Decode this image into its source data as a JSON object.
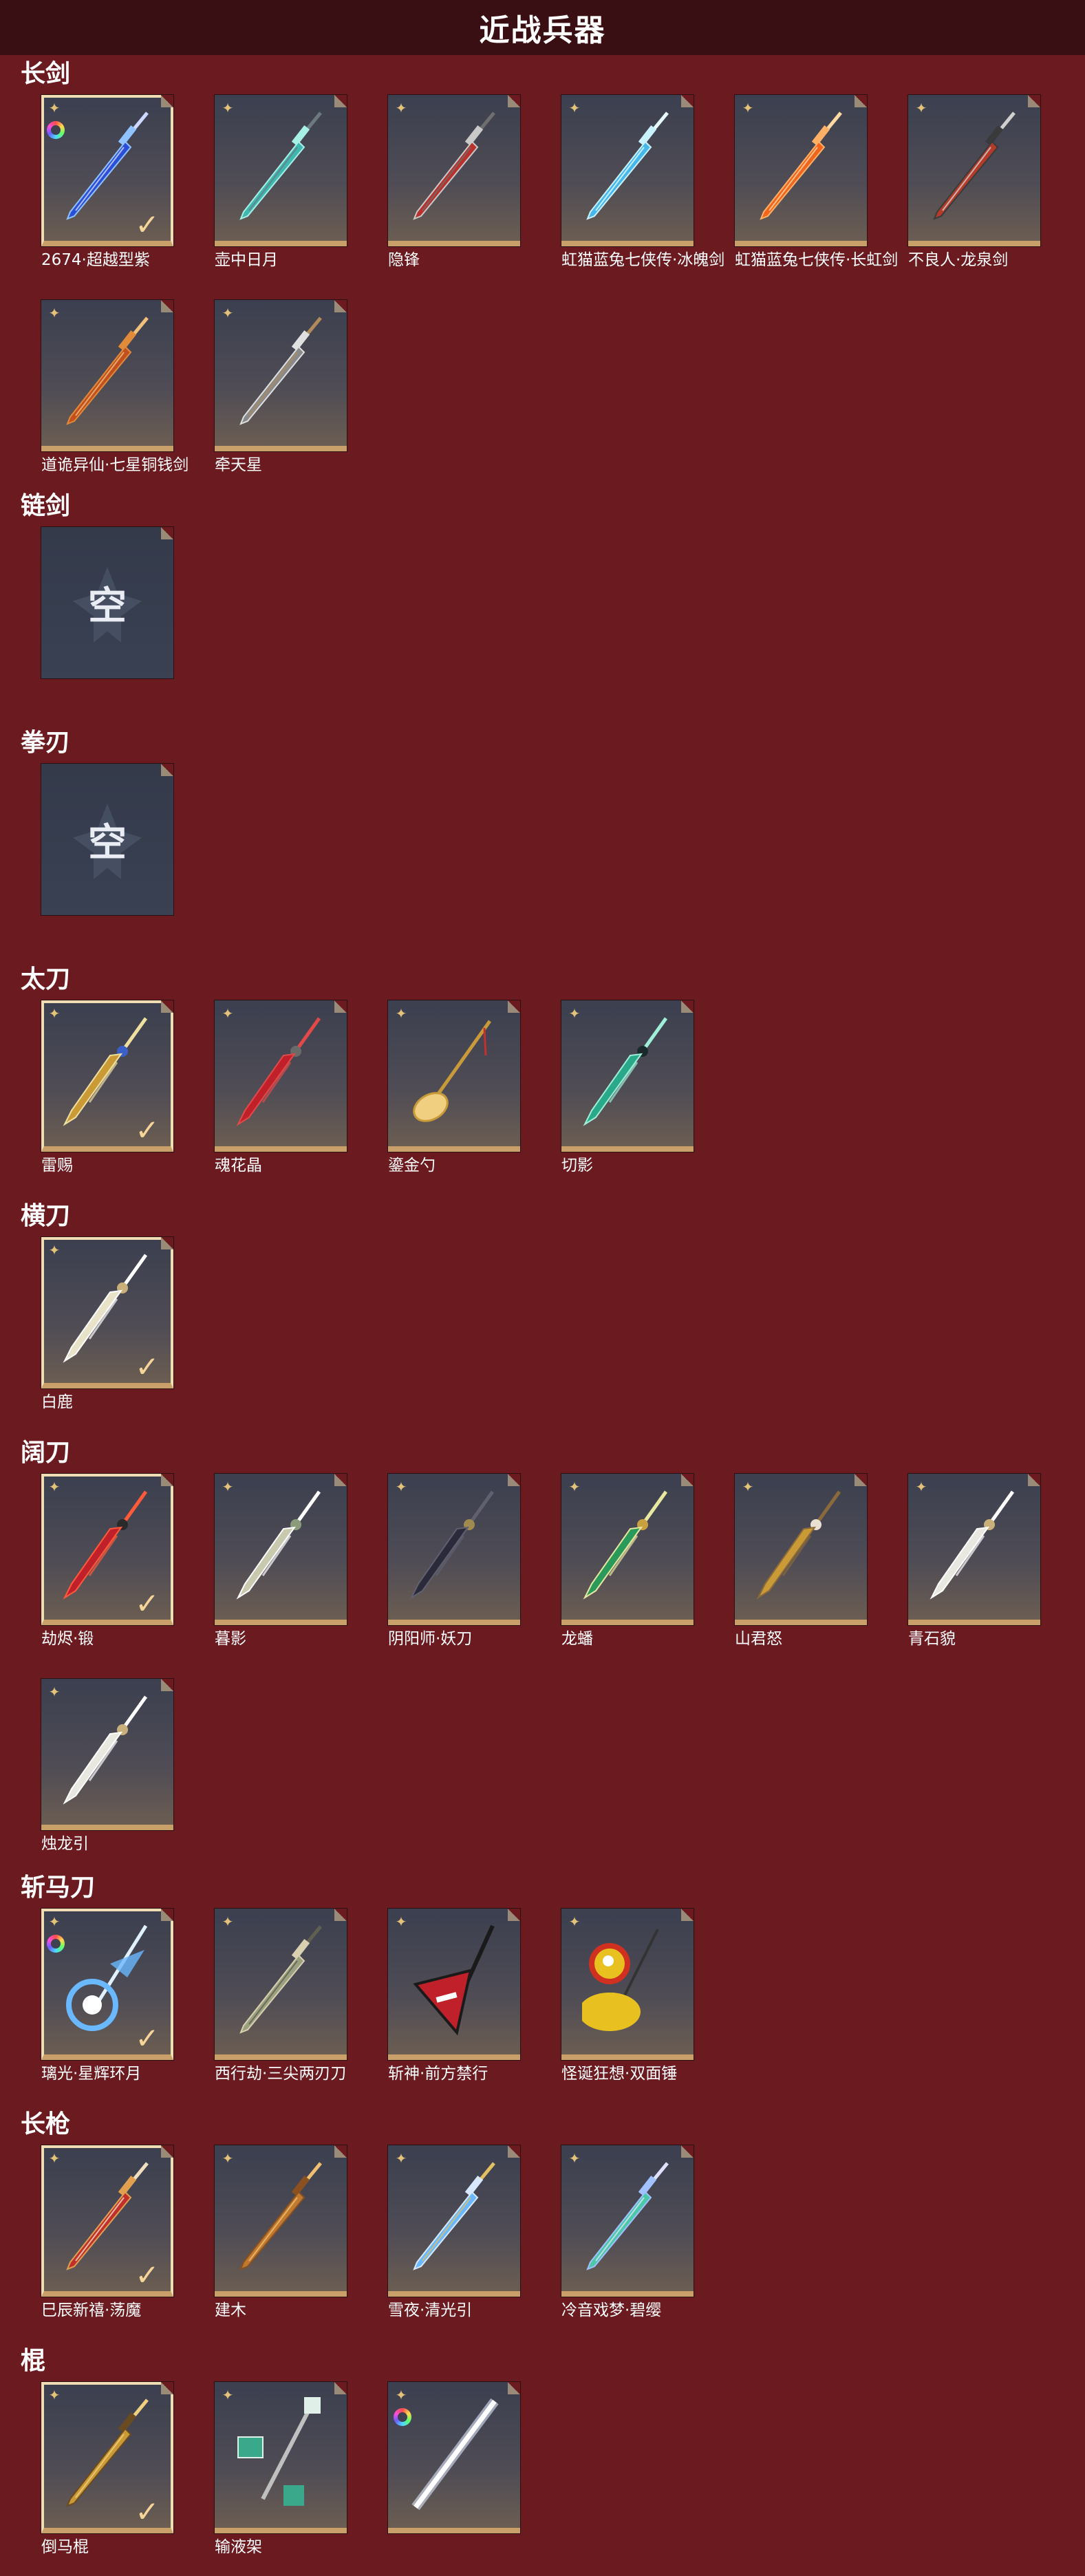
{
  "header": {
    "title": "近战兵器"
  },
  "sections": [
    {
      "title": "长剑",
      "items": [
        {
          "label": "2674·超越型紫",
          "selected": true,
          "rainbow": true,
          "art": "sword-blue"
        },
        {
          "label": "壶中日月",
          "art": "sword-cyan"
        },
        {
          "label": "隐锋",
          "art": "sword-red"
        },
        {
          "label": "虹猫蓝兔七侠传·冰魄剑",
          "art": "sword-ice"
        },
        {
          "label": "虹猫蓝兔七侠传·长虹剑",
          "art": "sword-orange"
        },
        {
          "label": "不良人·龙泉剑",
          "art": "sword-dark"
        },
        {
          "label": "道诡异仙·七星铜钱剑",
          "art": "sword-coin"
        },
        {
          "label": "牵天星",
          "art": "sword-silver"
        }
      ]
    },
    {
      "title": "链剑",
      "items": [
        {
          "label": "",
          "empty": true,
          "empty_text": "空"
        }
      ]
    },
    {
      "title": "拳刃",
      "items": [
        {
          "label": "",
          "empty": true,
          "empty_text": "空"
        }
      ]
    },
    {
      "title": "太刀",
      "items": [
        {
          "label": "雷赐",
          "selected": true,
          "art": "blade-gold"
        },
        {
          "label": "魂花晶",
          "art": "blade-crimson"
        },
        {
          "label": "鎏金勺",
          "art": "spoon"
        },
        {
          "label": "切影",
          "art": "blade-jade"
        }
      ]
    },
    {
      "title": "横刀",
      "items": [
        {
          "label": "白鹿",
          "selected": true,
          "art": "blade-white"
        }
      ]
    },
    {
      "title": "阔刀",
      "items": [
        {
          "label": "劫烬·锻",
          "selected": true,
          "art": "broad-red"
        },
        {
          "label": "暮影",
          "art": "broad-silver"
        },
        {
          "label": "阴阳师·妖刀",
          "art": "broad-dark"
        },
        {
          "label": "龙蟠",
          "art": "broad-green"
        },
        {
          "label": "山君怒",
          "art": "broad-gold"
        },
        {
          "label": "青石貌",
          "art": "broad-white"
        },
        {
          "label": "烛龙引",
          "art": "broad-white"
        }
      ]
    },
    {
      "title": "斩马刀",
      "items": [
        {
          "label": "璃光·星辉环月",
          "selected": true,
          "rainbow": true,
          "art": "zhanma-moon"
        },
        {
          "label": "西行劫·三尖两刃刀",
          "art": "zhanma-trident"
        },
        {
          "label": "斩神·前方禁行",
          "art": "zhanma-sign"
        },
        {
          "label": "怪诞狂想·双面锤",
          "art": "zhanma-hammer"
        }
      ]
    },
    {
      "title": "长枪",
      "items": [
        {
          "label": "巳辰新禧·荡魔",
          "selected": true,
          "art": "spear-red"
        },
        {
          "label": "建木",
          "art": "spear-wood"
        },
        {
          "label": "雪夜·清光引",
          "art": "spear-ice"
        },
        {
          "label": "冷音戏梦·碧缨",
          "art": "spear-jade"
        }
      ]
    },
    {
      "title": "棍",
      "items": [
        {
          "label": "倒马棍",
          "selected": true,
          "art": "staff-gold"
        },
        {
          "label": "输液架",
          "art": "staff-iv"
        },
        {
          "label": "",
          "rainbow": true,
          "art": "staff-light"
        }
      ]
    }
  ],
  "colors": {
    "background": "#6b1a1f",
    "header": "#3a0f14",
    "card_border": "#caa06a",
    "selected_border": "#f1ddb4",
    "rarity": "#e5c27a"
  }
}
